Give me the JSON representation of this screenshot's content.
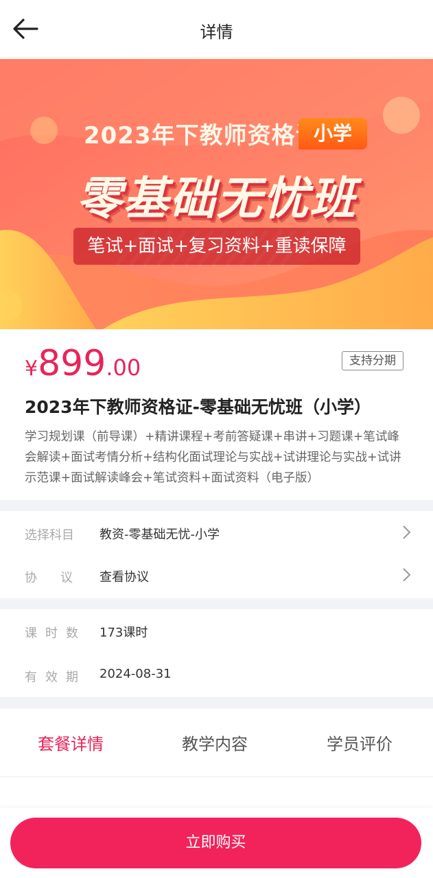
{
  "header": {
    "title": "详情",
    "back_icon": "arrow-left-icon"
  },
  "banner": {
    "year_text": "2023年下教师资格证",
    "badge_text": "小学",
    "main_text": "零基础无忧班",
    "pill_text": "笔试+面试+复习资料+重读保障",
    "colors": {
      "bg_start": "#ff6f61",
      "bg_end": "#ff9a6e",
      "wave": "#ffc04a"
    }
  },
  "product": {
    "price_symbol": "¥",
    "price_integer": "899",
    "price_decimal": ".00",
    "installment_label": "支持分期",
    "title": "2023年下教师资格证-零基础无忧班（小学）",
    "description": "学习规划课（前导课）+精讲课程+考前答疑课+串讲+习题课+笔试峰会解读+面试考情分析+结构化面试理论与实战+试讲理论与实战+试讲示范课+面试解读峰会+笔试资料+面试资料（电子版）"
  },
  "options": {
    "subject_label": "选择科目",
    "subject_value": "教资-零基础无忧-小学",
    "agreement_label": "协议",
    "agreement_value": "查看协议"
  },
  "info": {
    "hours_label": "课时数",
    "hours_value": "173课时",
    "validity_label": "有效期",
    "validity_value": "2024-08-31"
  },
  "tabs": [
    {
      "label": "套餐详情",
      "active": true
    },
    {
      "label": "教学内容",
      "active": false
    },
    {
      "label": "学员评价",
      "active": false
    }
  ],
  "footer": {
    "buy_label": "立即购买"
  },
  "colors": {
    "accent": "#e8245a",
    "buy_button": "#f2235a",
    "divider": "#f2f3f7"
  }
}
